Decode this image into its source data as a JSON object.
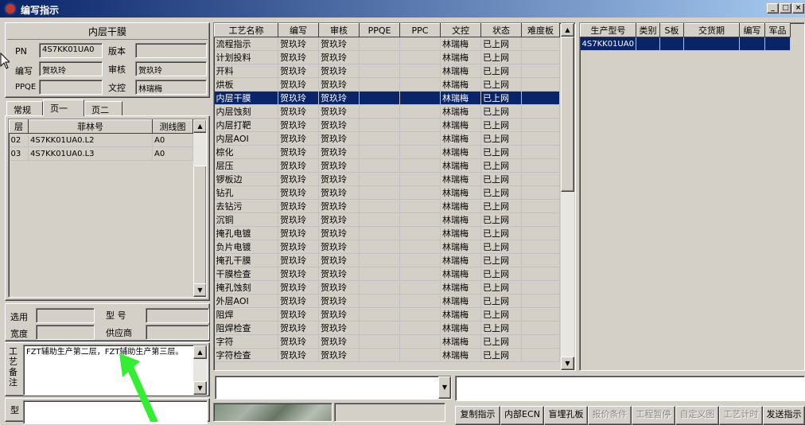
{
  "window": {
    "title": "编写指示",
    "minimize": "_",
    "maximize": "□",
    "close": "×"
  },
  "header": {
    "panel_title": "内层干膜",
    "pn_label": "PN",
    "pn_value": "4S7KK01UA0",
    "version_label": "版本",
    "version_value": "",
    "author_label": "编写",
    "author_value": "贺玖玲",
    "reviewer_label": "审核",
    "reviewer_value": "贺玖玲",
    "ppqe_label": "PPQE",
    "ppqe_value": "",
    "doc_control_label": "文控",
    "doc_control_value": "林瑞梅"
  },
  "left_tabs": [
    "常规",
    "页一",
    "页二"
  ],
  "layer_table": {
    "columns": [
      "层",
      "菲林号",
      "测线图"
    ],
    "rows": [
      [
        "02",
        "4S7KK01UA0.L2",
        "A0"
      ],
      [
        "03",
        "4S7KK01UA0.L3",
        "A0"
      ]
    ]
  },
  "options": {
    "select_label": "选用",
    "select_value": "",
    "model_label": "型  号",
    "model_value": "",
    "width_label": "宽度",
    "width_value": "",
    "supplier_label": "供应商",
    "supplier_value": ""
  },
  "remarks": {
    "label": "工艺备注",
    "text": "FZT辅助生产第二层，FZT辅助生产第三层。"
  },
  "type_label": "型",
  "process_table": {
    "columns": [
      "工艺名称",
      "编写",
      "审核",
      "PPQE",
      "PPC",
      "文控",
      "状态",
      "难度板"
    ],
    "selected_index": 4,
    "rows": [
      [
        "流程指示",
        "贺玖玲",
        "贺玖玲",
        "",
        "",
        "林瑞梅",
        "已上网",
        ""
      ],
      [
        "计划投料",
        "贺玖玲",
        "贺玖玲",
        "",
        "",
        "林瑞梅",
        "已上网",
        ""
      ],
      [
        "开料",
        "贺玖玲",
        "贺玖玲",
        "",
        "",
        "林瑞梅",
        "已上网",
        ""
      ],
      [
        "烘板",
        "贺玖玲",
        "贺玖玲",
        "",
        "",
        "林瑞梅",
        "已上网",
        ""
      ],
      [
        "内层干膜",
        "贺玖玲",
        "贺玖玲",
        "",
        "",
        "林瑞梅",
        "已上网",
        ""
      ],
      [
        "内层蚀刻",
        "贺玖玲",
        "贺玖玲",
        "",
        "",
        "林瑞梅",
        "已上网",
        ""
      ],
      [
        "内层打靶",
        "贺玖玲",
        "贺玖玲",
        "",
        "",
        "林瑞梅",
        "已上网",
        ""
      ],
      [
        "内层AOI",
        "贺玖玲",
        "贺玖玲",
        "",
        "",
        "林瑞梅",
        "已上网",
        ""
      ],
      [
        "棕化",
        "贺玖玲",
        "贺玖玲",
        "",
        "",
        "林瑞梅",
        "已上网",
        ""
      ],
      [
        "层压",
        "贺玖玲",
        "贺玖玲",
        "",
        "",
        "林瑞梅",
        "已上网",
        ""
      ],
      [
        "锣板边",
        "贺玖玲",
        "贺玖玲",
        "",
        "",
        "林瑞梅",
        "已上网",
        ""
      ],
      [
        "钻孔",
        "贺玖玲",
        "贺玖玲",
        "",
        "",
        "林瑞梅",
        "已上网",
        ""
      ],
      [
        "去钻污",
        "贺玖玲",
        "贺玖玲",
        "",
        "",
        "林瑞梅",
        "已上网",
        ""
      ],
      [
        "沉铜",
        "贺玖玲",
        "贺玖玲",
        "",
        "",
        "林瑞梅",
        "已上网",
        ""
      ],
      [
        "掩孔电镀",
        "贺玖玲",
        "贺玖玲",
        "",
        "",
        "林瑞梅",
        "已上网",
        ""
      ],
      [
        "负片电镀",
        "贺玖玲",
        "贺玖玲",
        "",
        "",
        "林瑞梅",
        "已上网",
        ""
      ],
      [
        "掩孔干膜",
        "贺玖玲",
        "贺玖玲",
        "",
        "",
        "林瑞梅",
        "已上网",
        ""
      ],
      [
        "干膜检查",
        "贺玖玲",
        "贺玖玲",
        "",
        "",
        "林瑞梅",
        "已上网",
        ""
      ],
      [
        "掩孔蚀刻",
        "贺玖玲",
        "贺玖玲",
        "",
        "",
        "林瑞梅",
        "已上网",
        ""
      ],
      [
        "外层AOI",
        "贺玖玲",
        "贺玖玲",
        "",
        "",
        "林瑞梅",
        "已上网",
        ""
      ],
      [
        "阻焊",
        "贺玖玲",
        "贺玖玲",
        "",
        "",
        "林瑞梅",
        "已上网",
        ""
      ],
      [
        "阻焊检查",
        "贺玖玲",
        "贺玖玲",
        "",
        "",
        "林瑞梅",
        "已上网",
        ""
      ],
      [
        "字符",
        "贺玖玲",
        "贺玖玲",
        "",
        "",
        "林瑞梅",
        "已上网",
        ""
      ],
      [
        "字符检查",
        "贺玖玲",
        "贺玖玲",
        "",
        "",
        "林瑞梅",
        "已上网",
        ""
      ]
    ]
  },
  "product_table": {
    "columns": [
      "生产型号",
      "类别",
      "S板",
      "交货期",
      "编写",
      "军品"
    ],
    "rows": [
      [
        "4S7KK01UA0",
        "",
        "",
        "",
        "",
        ""
      ]
    ]
  },
  "bottom_buttons": [
    {
      "label": "复制指示",
      "enabled": true
    },
    {
      "label": "内部ECN",
      "enabled": true
    },
    {
      "label": "盲埋孔板",
      "enabled": true
    },
    {
      "label": "报价条件",
      "enabled": false
    },
    {
      "label": "工程暂停",
      "enabled": false
    },
    {
      "label": "自定义图",
      "enabled": false
    },
    {
      "label": "工艺计时",
      "enabled": false
    },
    {
      "label": "发送指示",
      "enabled": true
    }
  ],
  "colors": {
    "window_bg": "#d4d0c8",
    "selection": "#0a246a",
    "annotation_arrow": "#33ee33"
  }
}
